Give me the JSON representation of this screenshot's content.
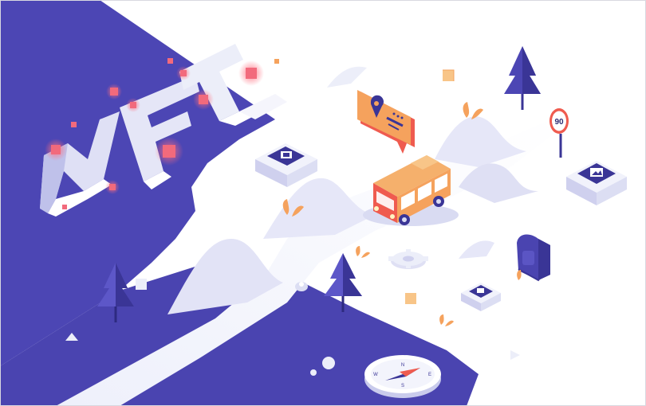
{
  "illustration": {
    "headline_letters": "NFT",
    "speed_sign": "90",
    "compass_letters": {
      "north": "N",
      "south": "S",
      "east": "E",
      "west": "W"
    }
  },
  "colors": {
    "indigo": "#4a44b0",
    "indigo_dark": "#3a3596",
    "lavender": "#e8e8f7",
    "lavender_shadow": "#cfd0ee",
    "orange": "#f5a25d",
    "coral": "#ef5b4f",
    "pink_glow": "#f47a8a",
    "white": "#ffffff"
  },
  "icons": [
    "map-pin-icon",
    "image-icon",
    "film-icon",
    "speed-limit-icon",
    "gear-icon",
    "compass-icon",
    "backpack-icon",
    "tree-icon"
  ]
}
